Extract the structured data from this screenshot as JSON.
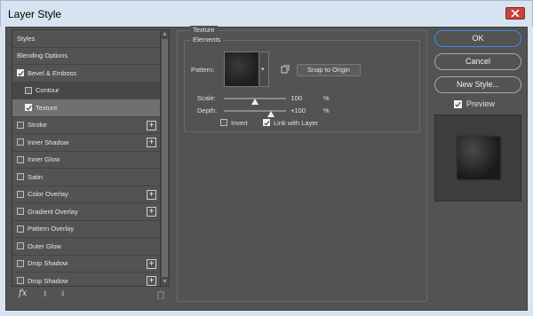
{
  "window": {
    "title": "Layer Style"
  },
  "styles_panel": {
    "items": [
      {
        "label": "Styles",
        "kind": "header"
      },
      {
        "label": "Blending Options",
        "kind": "header"
      },
      {
        "label": "Bevel & Emboss",
        "checked": true,
        "plus": false
      },
      {
        "label": "Contour",
        "checked": false,
        "sub": true
      },
      {
        "label": "Texture",
        "checked": true,
        "sub": true,
        "selected": true
      },
      {
        "label": "Stroke",
        "checked": false,
        "plus": true
      },
      {
        "label": "Inner Shadow",
        "checked": false,
        "plus": true
      },
      {
        "label": "Inner Glow",
        "checked": false,
        "plus": false
      },
      {
        "label": "Satin",
        "checked": false,
        "plus": false
      },
      {
        "label": "Color Overlay",
        "checked": false,
        "plus": true
      },
      {
        "label": "Gradient Overlay",
        "checked": false,
        "plus": true
      },
      {
        "label": "Pattern Overlay",
        "checked": false,
        "plus": false
      },
      {
        "label": "Outer Glow",
        "checked": false,
        "plus": false
      },
      {
        "label": "Drop Shadow",
        "checked": false,
        "plus": true
      },
      {
        "label": "Drop Shadow",
        "checked": false,
        "plus": true
      }
    ],
    "footer": {
      "fx_label": "fx"
    }
  },
  "texture": {
    "group_title": "Texture",
    "section_title": "Elements",
    "pattern_label": "Pattern:",
    "snap_button": "Snap to Origin",
    "scale_label": "Scale:",
    "scale_value": "100",
    "scale_fraction": 0.5,
    "depth_label": "Depth:",
    "depth_value": "+100",
    "depth_fraction": 0.75,
    "percent": "%",
    "invert_label": "Invert",
    "invert_checked": false,
    "link_label": "Link with Layer",
    "link_checked": true
  },
  "buttons": {
    "ok": "OK",
    "cancel": "Cancel",
    "new_style": "New Style...",
    "preview_label": "Preview",
    "preview_checked": true
  },
  "colors": {
    "panel_bg": "#535353",
    "accent": "#3a8be0",
    "title_bar": "#d7e3f0"
  }
}
